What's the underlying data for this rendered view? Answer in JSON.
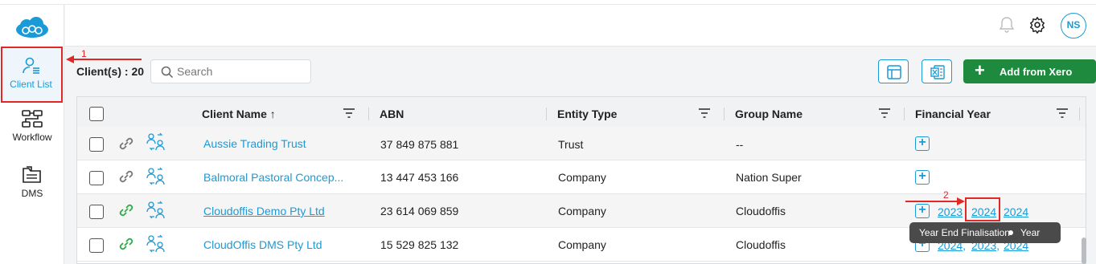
{
  "sidebar": {
    "items": [
      {
        "label": "Client List",
        "icon": "client-list-icon"
      },
      {
        "label": "Workflow",
        "icon": "workflow-icon"
      },
      {
        "label": "DMS",
        "icon": "dms-folder-icon"
      }
    ]
  },
  "header": {
    "avatar_initials": "NS"
  },
  "toolbar": {
    "client_count": "Client(s) : 20",
    "search_placeholder": "Search",
    "add_xero_label": "Add from Xero"
  },
  "table": {
    "columns": [
      "Client Name ↑",
      "ABN",
      "Entity Type",
      "Group Name",
      "Financial Year"
    ],
    "rows": [
      {
        "name": "Aussie Trading Trust",
        "abn": "37 849 875 881",
        "entity": "Trust",
        "group": "--",
        "years": []
      },
      {
        "name": "Balmoral Pastoral Concep...",
        "abn": "13 447 453 166",
        "entity": "Company",
        "group": "Nation Super",
        "years": []
      },
      {
        "name": "Cloudoffis Demo Pty Ltd",
        "abn": "23 614 069 859",
        "entity": "Company",
        "group": "Cloudoffis",
        "years": [
          "2023",
          "2024",
          "2024"
        ]
      },
      {
        "name": "CloudOffis DMS Pty Ltd",
        "abn": "15 529 825 132",
        "entity": "Company",
        "group": "Cloudoffis",
        "years": [
          "2024,",
          "2023,",
          "2024"
        ]
      }
    ]
  },
  "annotations": {
    "step1": "1",
    "step2": "2"
  },
  "tooltip": {
    "left": "Year End Finalisation",
    "right": "Year"
  },
  "colors": {
    "accent": "#1a9ad6",
    "xero_green": "#1e8a3e",
    "annotation_red": "#e32626",
    "link_active_green": "#2eaa4a"
  }
}
